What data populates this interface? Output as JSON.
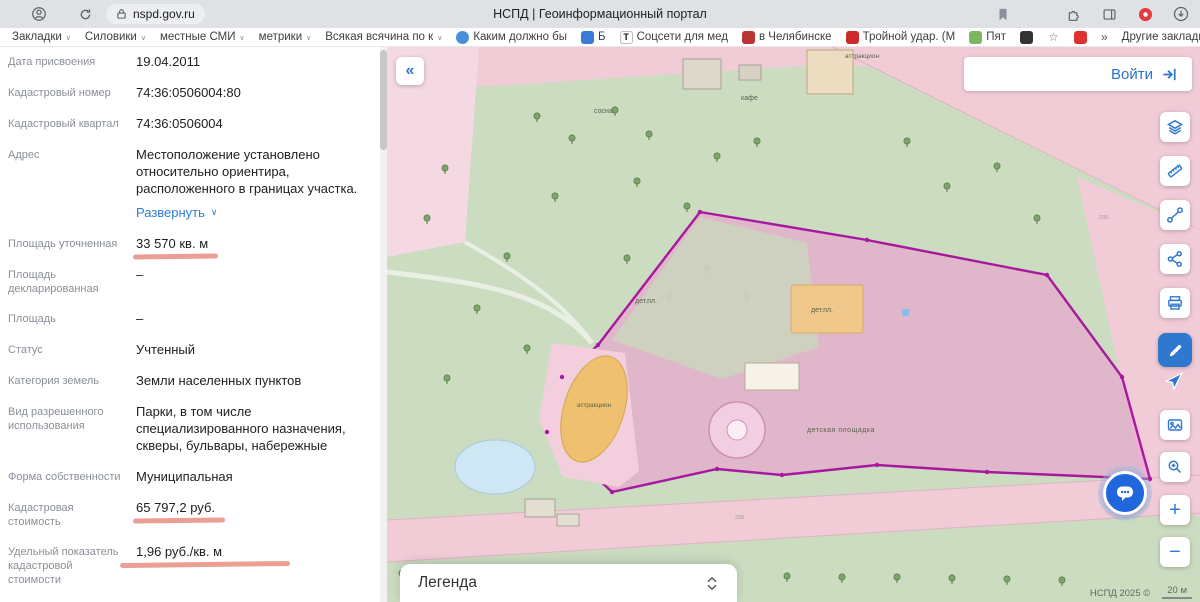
{
  "colors": {
    "accent_blue": "#2f78d0",
    "parcel_magenta": "#a8189e",
    "marker_red": "#e98d82",
    "map_green": "#cbdcc1",
    "map_pink": "#f1ccd7",
    "chat_blue": "#2066dd"
  },
  "browser": {
    "url": "nspd.gov.ru",
    "page_title": "НСПД | Геоинформационный портал",
    "bookmarks": [
      {
        "label": "Закладки"
      },
      {
        "label": "Силовики"
      },
      {
        "label": "местные СМИ"
      },
      {
        "label": "метрики"
      },
      {
        "label": "Всякая всячина по к"
      },
      {
        "label": "Каким должно бы"
      },
      {
        "label": "Б"
      },
      {
        "label": "Соцсети для мед",
        "icon_letter": "Т"
      },
      {
        "label": "в Челябинске"
      },
      {
        "label": "Тройной удар. (М"
      },
      {
        "label": "Пят"
      }
    ],
    "star_glyph": "☆",
    "overflow_chevron": "»",
    "other_bookmarks": "Другие закладки"
  },
  "panel": {
    "rows": [
      {
        "label": "Дата присвоения",
        "value": "19.04.2011"
      },
      {
        "label": "Кадастровый номер",
        "value": "74:36:0506004:80"
      },
      {
        "label": "Кадастровый квартал",
        "value": "74:36:0506004"
      },
      {
        "label": "Адрес",
        "value": "Местоположение установлено относительно ориентира, расположенного в границах участка.",
        "link": "Развернуть"
      },
      {
        "label": "Площадь уточненная",
        "value": "33 570 кв. м"
      },
      {
        "label": "Площадь декларированная",
        "value": "–"
      },
      {
        "label": "Площадь",
        "value": "–"
      },
      {
        "label": "Статус",
        "value": "Учтенный"
      },
      {
        "label": "Категория земель",
        "value": "Земли населенных пунктов"
      },
      {
        "label": "Вид разрешенного использования",
        "value": "Парки, в том числе специализированного назначения, скверы, бульвары, набережные"
      },
      {
        "label": "Форма собственности",
        "value": "Муниципальная"
      },
      {
        "label": "Кадастровая стоимость",
        "value": "65 797,2 руб."
      },
      {
        "label": "Удельный показатель кадастровой стоимости",
        "value": "1,96 руб./кв. м"
      }
    ]
  },
  "map": {
    "collapse_label": "«",
    "login_label": "Войти",
    "zoom_in": "+",
    "zoom_out": "−",
    "legend_title": "Легенда",
    "attribution": "НСПД 2025 ©",
    "scale": "20 м",
    "labels": {
      "pine": "сосна",
      "cafe": "кафе",
      "attraction_top": "аттракцион",
      "playground_small_left": "дет.пл.",
      "playground_small_right": "дет.пл.",
      "attraction_area": "аттракцион",
      "playground_big": "детская площадка",
      "num_236": "236",
      "num_235": "235"
    }
  }
}
